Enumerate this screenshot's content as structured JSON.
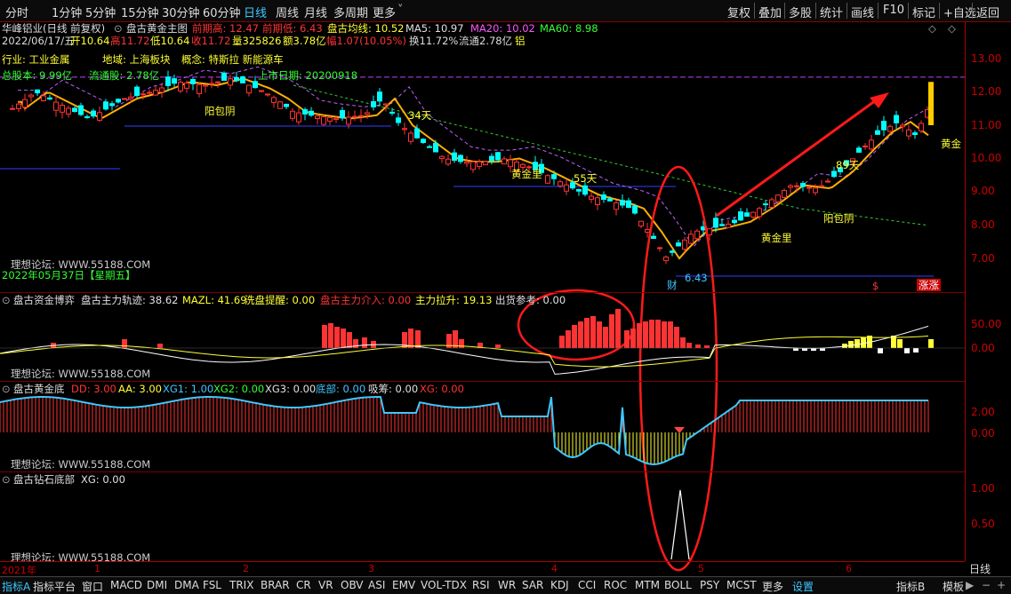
{
  "toolbar": {
    "left_tabs": [
      "分时",
      "1分钟",
      "5分钟",
      "15分钟",
      "30分钟",
      "60分钟",
      "日线",
      "周线",
      "月线",
      "多周期",
      "更多"
    ],
    "active_tab": "日线",
    "right_buttons": [
      "复权",
      "叠加",
      "多股",
      "统计",
      "画线",
      "F10",
      "标记",
      "+自选",
      "返回"
    ]
  },
  "main": {
    "stock_name": "华峰铝业(日线 前复权)",
    "indicator_name": "盘古黄金主图",
    "prev_high_label": "前期高: 12.47",
    "prev_low_label": "前期低: 6.43",
    "avg_line_label": "盘古均线: 10.52",
    "ma5_label": "MA5: 10.97",
    "ma20_label": "MA20: 10.02",
    "ma60_label": "MA60: 8.98",
    "quote_line": {
      "date": "2022/06/17/五",
      "open": "开10.64",
      "high": "高11.72",
      "low": "低10.64",
      "close": "收11.72",
      "volume": "量325826",
      "amount": "额3.78亿",
      "change": "幅1.07(10.05%)",
      "turnover": "换11.72%",
      "float": "流通2.78亿",
      "sector": "铝"
    },
    "concepts_line1": "行业: 工业金属",
    "concepts_line1b": "地域: 上海板块",
    "concepts_line1c": "概念: 特斯拉 新能源车",
    "concepts_line2a": "总股本: 9.99亿",
    "concepts_line2b": "流通股: 2.78亿",
    "concepts_line2c": "上市日期: 20200918",
    "annotations": {
      "yangbaoyin_1": "阳包阴",
      "yangbaoyin_2": "阳包阴",
      "day34": "34天",
      "day55": "55天",
      "day89": "89天",
      "huangjinli_1": "黄金里",
      "huangjinli_2": "黄金里",
      "huangjin_right": "黄金",
      "low_value": "6.43",
      "cai": "财",
      "watermark": "理想论坛: WWW.55188.COM",
      "date_label": "2022年05月37日【星期五】",
      "dollar": "$",
      "zhangting": "涨涨"
    },
    "y_axis": [
      "13.00",
      "12.00",
      "11.00",
      "10.00",
      "9.00",
      "8.00",
      "7.00"
    ]
  },
  "panel2": {
    "title": "盘古资金博弈",
    "labels": [
      {
        "text": "盘古主力轨迹: 38.62",
        "color": "#e0e0e0"
      },
      {
        "text": "MAZL: 41.69",
        "color": "#ffff33"
      },
      {
        "text": "洗盘提醒: 0.00",
        "color": "#ffff33"
      },
      {
        "text": "盘古主力介入: 0.00",
        "color": "#ff3333"
      },
      {
        "text": "主力拉升: 19.13",
        "color": "#ffff33"
      },
      {
        "text": "出货参考: 0.00",
        "color": "#e0e0e0"
      }
    ],
    "y_axis": [
      "50.00",
      "0.00"
    ],
    "watermark": "理想论坛: WWW.55188.COM"
  },
  "panel3": {
    "title": "盘古黄金底",
    "labels": [
      {
        "text": "DD: 3.00",
        "color": "#ff3333"
      },
      {
        "text": "AA: 3.00",
        "color": "#ffff33"
      },
      {
        "text": "XG1: 1.00",
        "color": "#3ec8ff"
      },
      {
        "text": "XG2: 0.00",
        "color": "#33ff33"
      },
      {
        "text": "XG3: 0.00",
        "color": "#e0e0e0"
      },
      {
        "text": "底部: 0.00",
        "color": "#3ec8ff"
      },
      {
        "text": "吸筹: 0.00",
        "color": "#e0e0e0"
      },
      {
        "text": "XG: 0.00",
        "color": "#ff3333"
      }
    ],
    "y_axis": [
      "2.00",
      "0.00"
    ],
    "watermark": "理想论坛: WWW.55188.COM"
  },
  "panel4": {
    "title": "盘古钻石底部",
    "label": "XG: 0.00",
    "y_axis": [
      "1.00",
      "0.50"
    ],
    "watermark": "理想论坛: WWW.55188.COM"
  },
  "time_axis": [
    "2021年",
    "1",
    "2",
    "3",
    "4",
    "5",
    "6"
  ],
  "time_axis_right": "日线",
  "bottom_tabs": [
    "指标A",
    "指标平台",
    "窗口",
    "MACD",
    "DMI",
    "DMA",
    "FSL",
    "TRIX",
    "BRAR",
    "CR",
    "VR",
    "OBV",
    "ASI",
    "EMV",
    "VOL-TDX",
    "RSI",
    "WR",
    "SAR",
    "KDJ",
    "CCI",
    "ROC",
    "MTM",
    "BOLL",
    "PSY",
    "MCST",
    "更多",
    "设置"
  ],
  "bottom_right": [
    "指标B",
    "模板"
  ],
  "colors": {
    "up": "#ff3333",
    "down": "#00ffff",
    "accent": "#3ec8ff",
    "grid": "#7a0000",
    "ma_yellow": "#ffb000"
  }
}
